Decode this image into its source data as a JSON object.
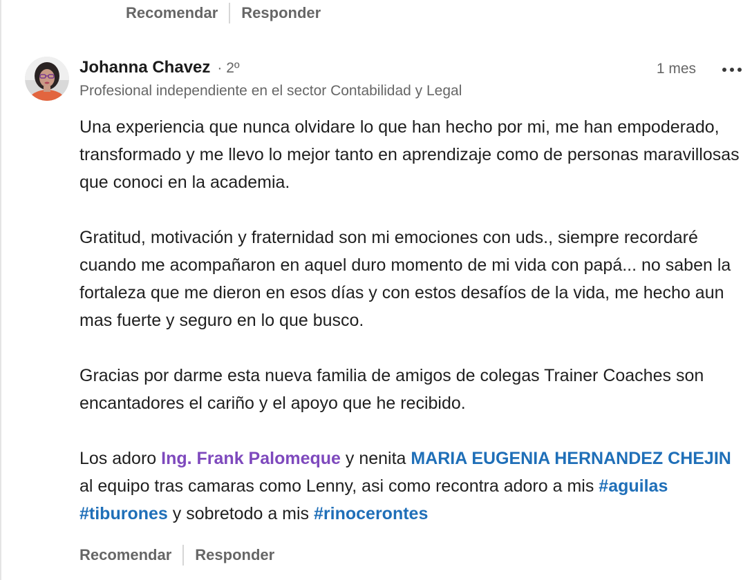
{
  "previous_comment": {
    "actions": {
      "recommend": "Recomendar",
      "reply": "Responder"
    }
  },
  "comment": {
    "author": {
      "name": "Johanna Chavez",
      "degree": "· 2º",
      "headline": "Profesional independiente en el sector Contabilidad y Legal",
      "avatar_icon": "profile-photo"
    },
    "time": "1 mes",
    "more_icon": "ellipsis-icon",
    "paragraphs": {
      "p1": "Una experiencia que nunca olvidare lo que han hecho por mi, me han empoderado, transformado y me llevo lo mejor tanto en aprendizaje como de personas maravillosas que conoci en la academia.",
      "p2": "Gratitud, motivación y fraternidad son mi emociones con uds., siempre recordaré cuando me acompañaron en aquel duro momento de mi vida con papá... no saben la fortaleza que me dieron en esos días y con estos desafíos de la vida, me hecho aun mas fuerte y seguro en lo que busco.",
      "p3": "Gracias por darme esta nueva familia de amigos de colegas Trainer Coaches son encantadores el cariño y el apoyo que he recibido.",
      "p4": {
        "t1": "Los adoro ",
        "mention1": "Ing. Frank Palomeque",
        "t2": " y nenita ",
        "mention2": "MARIA EUGENIA HERNANDEZ CHEJIN",
        "t3": " al equipo tras camaras como Lenny, asi como recontra adoro a mis ",
        "hashtag1": "#aguilas",
        "t4": " ",
        "hashtag2": "#tiburones",
        "t5": " y sobretodo a mis ",
        "hashtag3": "#rinocerontes"
      }
    },
    "actions": {
      "recommend": "Recomendar",
      "reply": "Responder"
    }
  },
  "colors": {
    "mention_purple": "#7e49bd",
    "link_blue": "#1f6fb8",
    "muted_text": "#666666"
  }
}
